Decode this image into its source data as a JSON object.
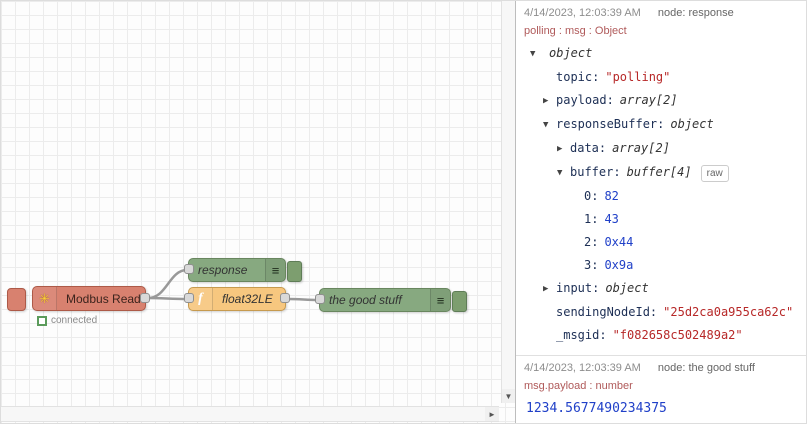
{
  "canvas": {
    "modbus": {
      "label": "Modbus Read",
      "status": "connected"
    },
    "response_node": {
      "label": "response"
    },
    "function_node": {
      "label": "float32LE",
      "icon": "f"
    },
    "good_node": {
      "label": "the good stuff"
    },
    "scroll": {
      "down_arrow": "▼",
      "right_arrow": "►"
    }
  },
  "sidebar": {
    "raw_label": "raw",
    "msg1": {
      "timestamp": "4/14/2023, 12:03:39 AM",
      "node": "node: response",
      "path": "polling : msg : Object",
      "rows": [
        {
          "caret": "▼",
          "key": "",
          "value": "object"
        },
        {
          "caret": "",
          "key": "topic:",
          "value": "\"polling\""
        },
        {
          "caret": "▶",
          "key": "payload:",
          "value": "array[2]"
        },
        {
          "caret": "▼",
          "key": "responseBuffer:",
          "value": "object"
        },
        {
          "caret": "▶",
          "key": "data:",
          "value": "array[2]"
        },
        {
          "caret": "▼",
          "key": "buffer:",
          "value": "buffer[4]"
        },
        {
          "caret": "",
          "key": "0:",
          "value": "82"
        },
        {
          "caret": "",
          "key": "1:",
          "value": "43"
        },
        {
          "caret": "",
          "key": "2:",
          "value": "0x44"
        },
        {
          "caret": "",
          "key": "3:",
          "value": "0x9a"
        },
        {
          "caret": "▶",
          "key": "input:",
          "value": "object"
        },
        {
          "caret": "",
          "key": "sendingNodeId:",
          "value": "\"25d2ca0a955ca62c\""
        },
        {
          "caret": "",
          "key": "_msgid:",
          "value": "\"f082658c502489a2\""
        }
      ]
    },
    "msg2": {
      "timestamp": "4/14/2023, 12:03:39 AM",
      "node": "node: the good stuff",
      "path": "msg.payload : number",
      "value": "1234.5677490234375"
    }
  }
}
